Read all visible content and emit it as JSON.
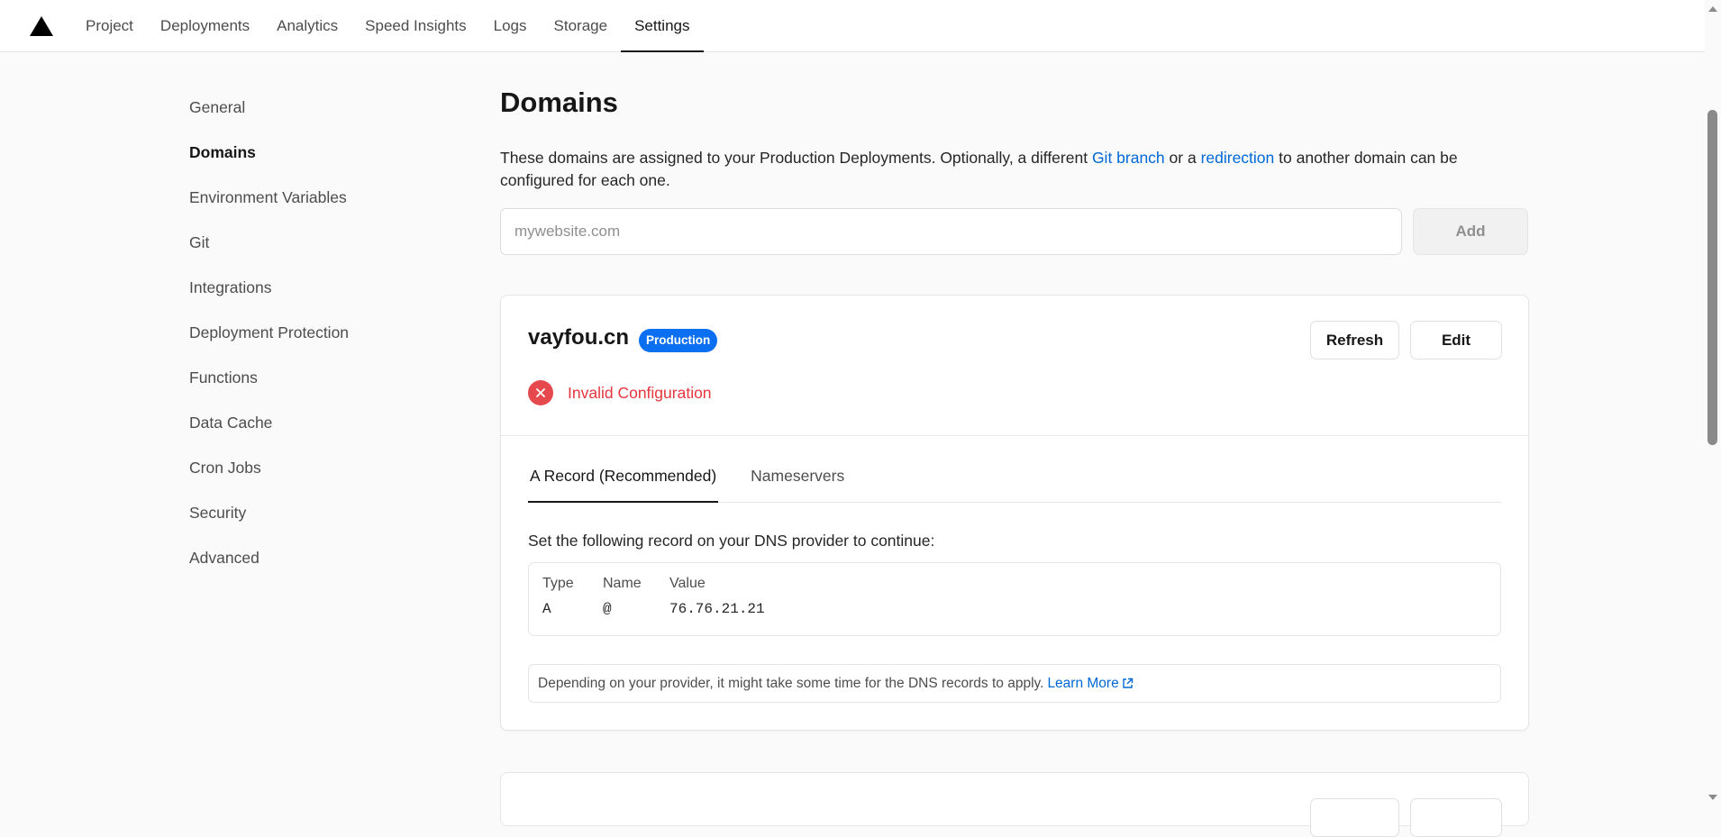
{
  "nav": {
    "logo_icon": "triangle-logo-icon",
    "tabs": [
      {
        "label": "Project"
      },
      {
        "label": "Deployments"
      },
      {
        "label": "Analytics"
      },
      {
        "label": "Speed Insights"
      },
      {
        "label": "Logs"
      },
      {
        "label": "Storage"
      },
      {
        "label": "Settings",
        "active": true
      }
    ]
  },
  "sidebar": {
    "items": [
      {
        "label": "General"
      },
      {
        "label": "Domains",
        "active": true
      },
      {
        "label": "Environment Variables"
      },
      {
        "label": "Git"
      },
      {
        "label": "Integrations"
      },
      {
        "label": "Deployment Protection"
      },
      {
        "label": "Functions"
      },
      {
        "label": "Data Cache"
      },
      {
        "label": "Cron Jobs"
      },
      {
        "label": "Security"
      },
      {
        "label": "Advanced"
      }
    ]
  },
  "main": {
    "title": "Domains",
    "intro": {
      "part1": "These domains are assigned to your Production Deployments. Optionally, a different ",
      "link1": "Git branch",
      "part2": " or a ",
      "link2": "redirection",
      "part3": " to another domain can be configured for each one."
    },
    "add": {
      "placeholder": "mywebsite.com",
      "button_label": "Add"
    }
  },
  "domain_card": {
    "name": "vayfou.cn",
    "badge": "Production",
    "refresh_label": "Refresh",
    "edit_label": "Edit",
    "status": "Invalid Configuration",
    "status_icon": "error-x-icon",
    "tabs": [
      {
        "label": "A Record (Recommended)",
        "active": true
      },
      {
        "label": "Nameservers"
      }
    ],
    "dns_intro": "Set the following record on your DNS provider to continue:",
    "record": {
      "headers": [
        "Type",
        "Name",
        "Value"
      ],
      "values": [
        "A",
        "@",
        "76.76.21.21"
      ]
    },
    "note": "Depending on your provider, it might take some time for the DNS records to apply.",
    "learn_more": "Learn More",
    "learn_more_icon": "external-link-icon"
  },
  "colors": {
    "accent_blue": "#0068d6",
    "badge_blue": "#0a6ff0",
    "error_red": "#e5484d"
  }
}
